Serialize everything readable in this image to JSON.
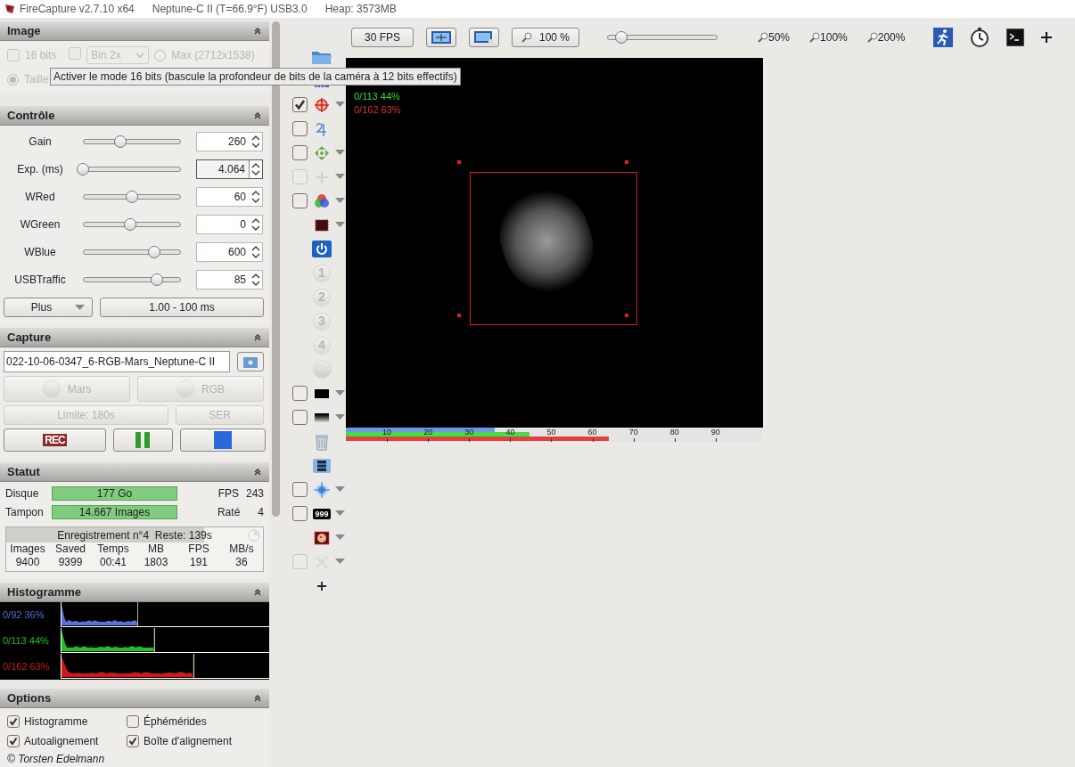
{
  "title_bar": {
    "app": "FireCapture v2.7.10 x64",
    "camera": "Neptune-C II (T=66.9°F) USB3.0",
    "heap": "Heap: 3573MB"
  },
  "image_panel": {
    "title": "Image",
    "disabled": true,
    "bits16": {
      "label": "16 bits",
      "checked": false
    },
    "bin": {
      "checked": false,
      "value": "Bin 2x"
    },
    "max": {
      "label": "Max (2712x1538)",
      "selected": false
    },
    "size": {
      "label": "Taille",
      "selected": true
    }
  },
  "tooltip": "Activer le mode 16 bits (bascule la profondeur de bits de la caméra à 12 bits effectifs)",
  "control_panel": {
    "title": "Contrôle",
    "plus_button": "Plus",
    "range_button": "1.00 - 100 ms",
    "controls": [
      {
        "label": "Gain",
        "level": 0.38,
        "value": "260",
        "focused": false
      },
      {
        "label": "Exp. (ms)",
        "level": 0.0,
        "value": "4.064",
        "focused": true
      },
      {
        "label": "WRed",
        "level": 0.5,
        "value": "60",
        "focused": false
      },
      {
        "label": "WGreen",
        "level": 0.48,
        "value": "0",
        "focused": false
      },
      {
        "label": "WBlue",
        "level": 0.73,
        "value": "600",
        "focused": false
      },
      {
        "label": "USBTraffic",
        "level": 0.75,
        "value": "85",
        "focused": false
      }
    ]
  },
  "capture_panel": {
    "title": "Capture",
    "filename": "022-10-06-0347_6-RGB-Mars_Neptune-C II",
    "object_button": "Mars",
    "filter_button": "RGB",
    "limit_button": "Limite: 180s",
    "format_button": "SER",
    "disabled": true,
    "rec_label": "REC"
  },
  "status_panel": {
    "title": "Statut",
    "disk_label": "Disque",
    "disk_value": "177 Go",
    "fps_label": "FPS",
    "fps_value": "243",
    "buffer_label": "Tampon",
    "buffer_value": "14.667 Images",
    "dropped_label": "Raté",
    "dropped_value": "4",
    "recording": {
      "text": "Enregistrement n°4  Reste: 139s",
      "level": 0.77
    },
    "columns": [
      "Images",
      "Saved",
      "Temps",
      "MB",
      "FPS",
      "MB/s"
    ],
    "values": [
      "9400",
      "9399",
      "00:41",
      "1803",
      "191",
      "36"
    ]
  },
  "histogram_panel": {
    "title": "Histogramme",
    "channels": [
      {
        "label": "0/92 36%",
        "color": "#5a6fd8",
        "level": 0.37
      },
      {
        "label": "0/113 44%",
        "color": "#22c022",
        "level": 0.45
      },
      {
        "label": "0/162 63%",
        "color": "#d01818",
        "level": 0.64
      }
    ]
  },
  "options_panel": {
    "title": "Options",
    "items": [
      {
        "label": "Histogramme",
        "checked": true
      },
      {
        "label": "Éphémérides",
        "checked": false
      },
      {
        "label": "Autoalignement",
        "checked": true
      },
      {
        "label": "Boîte d'alignement",
        "checked": true
      }
    ]
  },
  "footer": "© Torsten Edelmann",
  "toolbar": {
    "fps_button": "30 FPS",
    "zoom_button": "100 %",
    "zoom_slider": {
      "level": 0.13
    },
    "zoom_presets": [
      "50%",
      "100%",
      "200%"
    ]
  },
  "tools": [
    {
      "kind": "folder"
    },
    {
      "kind": "bars"
    },
    {
      "kind": "crosshair",
      "checked": true,
      "disabled": false,
      "dropdown": true
    },
    {
      "kind": "jupiter",
      "checked": false,
      "disabled": false,
      "dropdown": false
    },
    {
      "kind": "move",
      "checked": false,
      "disabled": false,
      "dropdown": true
    },
    {
      "kind": "cross",
      "checked": false,
      "disabled": true,
      "dropdown": true
    },
    {
      "kind": "rgb",
      "checked": false,
      "disabled": false,
      "dropdown": true
    },
    {
      "kind": "darkframe",
      "dropdown": true
    },
    {
      "kind": "power"
    },
    {
      "kind": "number",
      "label": "1"
    },
    {
      "kind": "number",
      "label": "2"
    },
    {
      "kind": "number",
      "label": "3"
    },
    {
      "kind": "number",
      "label": "4"
    },
    {
      "kind": "sphere"
    },
    {
      "kind": "blackrect",
      "checked": false,
      "disabled": false,
      "dropdown": true
    },
    {
      "kind": "gradient",
      "checked": false,
      "disabled": false,
      "dropdown": true
    },
    {
      "kind": "trash"
    },
    {
      "kind": "film"
    },
    {
      "kind": "target",
      "checked": false,
      "disabled": false,
      "dropdown": true
    },
    {
      "kind": "counter",
      "label": "999",
      "checked": false,
      "disabled": false,
      "dropdown": true
    },
    {
      "kind": "planet",
      "dropdown": true
    },
    {
      "kind": "scissors",
      "checked": false,
      "disabled": true,
      "dropdown": true
    },
    {
      "kind": "plus"
    }
  ],
  "viewer": {
    "overlay": [
      {
        "text": "0/113 44%",
        "color": "#33dd33"
      },
      {
        "text": "0/162 63%",
        "color": "#e03030"
      }
    ],
    "meters": [
      {
        "color": "#6a9ae8",
        "level": 0.357
      },
      {
        "color": "#44dd44",
        "level": 0.44
      },
      {
        "color": "#e44040",
        "level": 0.63
      }
    ],
    "ticks": [
      "10",
      "20",
      "30",
      "40",
      "50",
      "60",
      "70",
      "80",
      "90"
    ]
  }
}
